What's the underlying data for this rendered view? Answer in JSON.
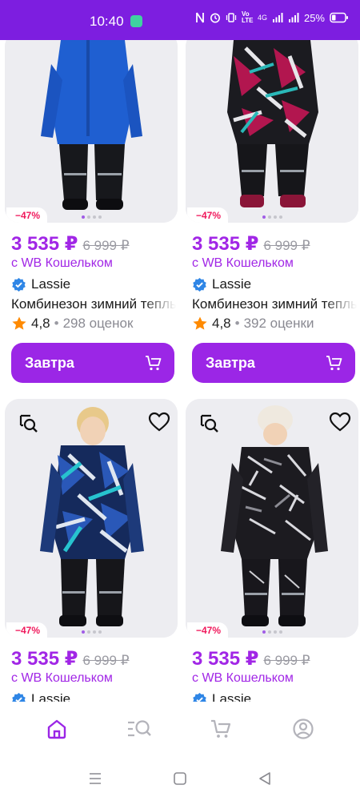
{
  "status": {
    "time": "10:40",
    "network": "4G",
    "volte": "Vo LTE",
    "battery": "25%"
  },
  "colors": {
    "brand": "#7d1ee0",
    "price": "#a126e6",
    "discount": "#f0195c",
    "button": "#9b26e6",
    "verified": "#2f86e6",
    "star": "#ff8a00"
  },
  "products": [
    {
      "discount": "−47%",
      "price": "3 535 ₽",
      "old_price": "6 999 ₽",
      "wallet_note": "с WB Кошельком",
      "brand": "Lassie",
      "title": "Комбинезон зимний теплый",
      "rating": "4,8",
      "reviews": "298 оценок",
      "button_label": "Завтра",
      "image_desc": "blue-snowsuit"
    },
    {
      "discount": "−47%",
      "price": "3 535 ₽",
      "old_price": "6 999 ₽",
      "wallet_note": "с WB Кошельком",
      "brand": "Lassie",
      "title": "Комбинезон зимний теплый",
      "rating": "4,8",
      "reviews": "392 оценки",
      "button_label": "Завтра",
      "image_desc": "pink-pattern-snowsuit"
    },
    {
      "discount": "−47%",
      "price": "3 535 ₽",
      "old_price": "6 999 ₽",
      "wallet_note": "с WB Кошельком",
      "brand": "Lassie",
      "image_desc": "navy-pattern-snowsuit"
    },
    {
      "discount": "−47%",
      "price": "3 535 ₽",
      "old_price": "6 999 ₽",
      "wallet_note": "с WB Кошельком",
      "brand": "Lassie",
      "image_desc": "black-pattern-snowsuit"
    }
  ],
  "bottom_nav": [
    {
      "icon": "home-icon",
      "active": true
    },
    {
      "icon": "catalog-search-icon",
      "active": false
    },
    {
      "icon": "cart-icon",
      "active": false
    },
    {
      "icon": "profile-icon",
      "active": false
    }
  ]
}
